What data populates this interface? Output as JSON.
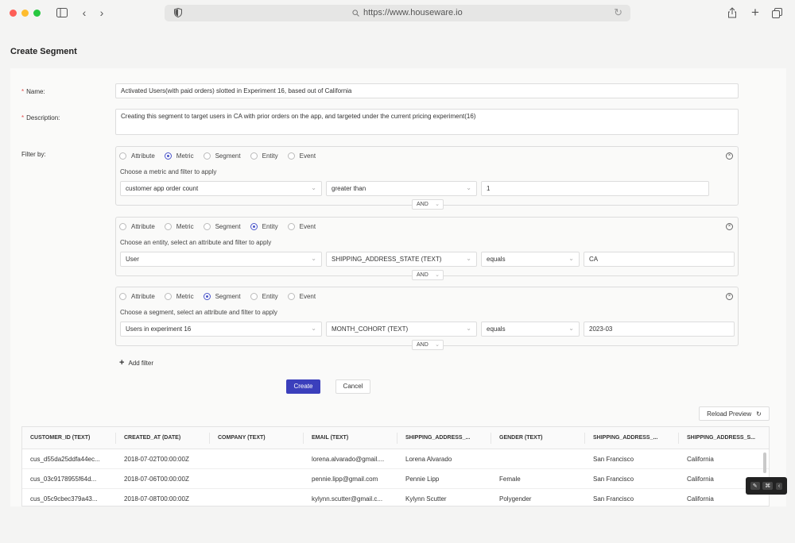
{
  "browser": {
    "url": "https://www.houseware.io"
  },
  "page": {
    "title": "Create Segment"
  },
  "form": {
    "name_label": "Name:",
    "name_value": "Activated Users(with paid orders) slotted in Experiment 16, based out of California",
    "description_label": "Description:",
    "description_value": "Creating this segment to target users in CA with prior orders on the app, and targeted under the current pricing experiment(16)",
    "filter_by_label": "Filter by:",
    "radio_options": [
      "Attribute",
      "Metric",
      "Segment",
      "Entity",
      "Event"
    ],
    "filters": [
      {
        "selected": "Metric",
        "hint": "Choose a metric and filter to apply",
        "field": "customer app order count",
        "operator": "greater than",
        "value": "1",
        "connector": "AND"
      },
      {
        "selected": "Entity",
        "hint": "Choose an entity, select an attribute and filter to apply",
        "field": "User",
        "attribute": "SHIPPING_ADDRESS_STATE (TEXT)",
        "operator": "equals",
        "value": "CA",
        "connector": "AND"
      },
      {
        "selected": "Segment",
        "hint": "Choose a segment, select an attribute and filter to apply",
        "field": "Users in experiment 16",
        "attribute": "MONTH_COHORT (TEXT)",
        "operator": "equals",
        "value": "2023-03",
        "connector": "AND"
      }
    ],
    "add_filter_label": "Add filter",
    "create_label": "Create",
    "cancel_label": "Cancel"
  },
  "preview": {
    "reload_label": "Reload Preview",
    "columns": [
      "CUSTOMER_ID (TEXT)",
      "CREATED_AT (DATE)",
      "COMPANY (TEXT)",
      "EMAIL (TEXT)",
      "SHIPPING_ADDRESS_...",
      "GENDER (TEXT)",
      "SHIPPING_ADDRESS_...",
      "SHIPPING_ADDRESS_S..."
    ],
    "rows": [
      [
        "cus_d55da25ddfa44ec...",
        "2018-07-02T00:00:00Z",
        "",
        "lorena.alvarado@gmail....",
        "Lorena Alvarado",
        "",
        "San Francisco",
        "California"
      ],
      [
        "cus_03c9178955f64d...",
        "2018-07-06T00:00:00Z",
        "",
        "pennie.lipp@gmail.com",
        "Pennie Lipp",
        "Female",
        "San Francisco",
        "California"
      ],
      [
        "cus_05c9cbec379a43...",
        "2018-07-08T00:00:00Z",
        "",
        "kylynn.scutter@gmail.c...",
        "Kylynn Scutter",
        "Polygender",
        "San Francisco",
        "California"
      ]
    ]
  },
  "colors": {
    "primary": "#3b3fbc",
    "required": "#e34d4d"
  }
}
